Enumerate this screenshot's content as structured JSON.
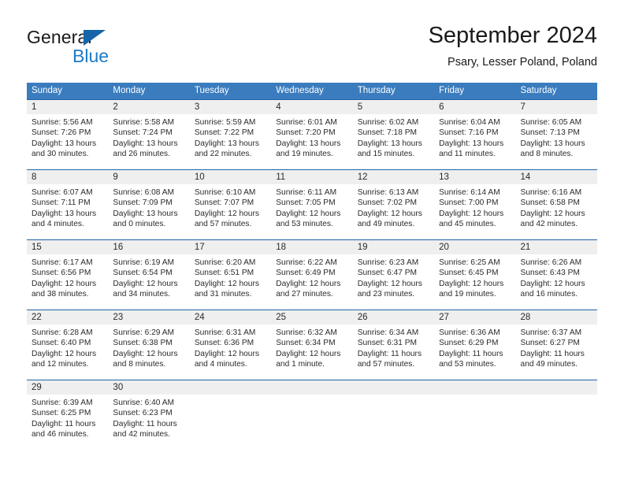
{
  "brand": {
    "name_line1": "General",
    "name_line2": "Blue",
    "triangle_icon": "triangle-icon"
  },
  "header": {
    "title": "September 2024",
    "subtitle": "Psary, Lesser Poland, Poland"
  },
  "colors": {
    "header_blue": "#3a7cbe",
    "rule_blue": "#1f64a8",
    "daynum_band": "#efefef",
    "brand_blue": "#1e7bc4",
    "text": "#2b2b2b"
  },
  "weekdays": [
    "Sunday",
    "Monday",
    "Tuesday",
    "Wednesday",
    "Thursday",
    "Friday",
    "Saturday"
  ],
  "weeks": [
    {
      "days": [
        {
          "num": "1",
          "sunrise": "Sunrise: 5:56 AM",
          "sunset": "Sunset: 7:26 PM",
          "daylight1": "Daylight: 13 hours",
          "daylight2": "and 30 minutes."
        },
        {
          "num": "2",
          "sunrise": "Sunrise: 5:58 AM",
          "sunset": "Sunset: 7:24 PM",
          "daylight1": "Daylight: 13 hours",
          "daylight2": "and 26 minutes."
        },
        {
          "num": "3",
          "sunrise": "Sunrise: 5:59 AM",
          "sunset": "Sunset: 7:22 PM",
          "daylight1": "Daylight: 13 hours",
          "daylight2": "and 22 minutes."
        },
        {
          "num": "4",
          "sunrise": "Sunrise: 6:01 AM",
          "sunset": "Sunset: 7:20 PM",
          "daylight1": "Daylight: 13 hours",
          "daylight2": "and 19 minutes."
        },
        {
          "num": "5",
          "sunrise": "Sunrise: 6:02 AM",
          "sunset": "Sunset: 7:18 PM",
          "daylight1": "Daylight: 13 hours",
          "daylight2": "and 15 minutes."
        },
        {
          "num": "6",
          "sunrise": "Sunrise: 6:04 AM",
          "sunset": "Sunset: 7:16 PM",
          "daylight1": "Daylight: 13 hours",
          "daylight2": "and 11 minutes."
        },
        {
          "num": "7",
          "sunrise": "Sunrise: 6:05 AM",
          "sunset": "Sunset: 7:13 PM",
          "daylight1": "Daylight: 13 hours",
          "daylight2": "and 8 minutes."
        }
      ]
    },
    {
      "days": [
        {
          "num": "8",
          "sunrise": "Sunrise: 6:07 AM",
          "sunset": "Sunset: 7:11 PM",
          "daylight1": "Daylight: 13 hours",
          "daylight2": "and 4 minutes."
        },
        {
          "num": "9",
          "sunrise": "Sunrise: 6:08 AM",
          "sunset": "Sunset: 7:09 PM",
          "daylight1": "Daylight: 13 hours",
          "daylight2": "and 0 minutes."
        },
        {
          "num": "10",
          "sunrise": "Sunrise: 6:10 AM",
          "sunset": "Sunset: 7:07 PM",
          "daylight1": "Daylight: 12 hours",
          "daylight2": "and 57 minutes."
        },
        {
          "num": "11",
          "sunrise": "Sunrise: 6:11 AM",
          "sunset": "Sunset: 7:05 PM",
          "daylight1": "Daylight: 12 hours",
          "daylight2": "and 53 minutes."
        },
        {
          "num": "12",
          "sunrise": "Sunrise: 6:13 AM",
          "sunset": "Sunset: 7:02 PM",
          "daylight1": "Daylight: 12 hours",
          "daylight2": "and 49 minutes."
        },
        {
          "num": "13",
          "sunrise": "Sunrise: 6:14 AM",
          "sunset": "Sunset: 7:00 PM",
          "daylight1": "Daylight: 12 hours",
          "daylight2": "and 45 minutes."
        },
        {
          "num": "14",
          "sunrise": "Sunrise: 6:16 AM",
          "sunset": "Sunset: 6:58 PM",
          "daylight1": "Daylight: 12 hours",
          "daylight2": "and 42 minutes."
        }
      ]
    },
    {
      "days": [
        {
          "num": "15",
          "sunrise": "Sunrise: 6:17 AM",
          "sunset": "Sunset: 6:56 PM",
          "daylight1": "Daylight: 12 hours",
          "daylight2": "and 38 minutes."
        },
        {
          "num": "16",
          "sunrise": "Sunrise: 6:19 AM",
          "sunset": "Sunset: 6:54 PM",
          "daylight1": "Daylight: 12 hours",
          "daylight2": "and 34 minutes."
        },
        {
          "num": "17",
          "sunrise": "Sunrise: 6:20 AM",
          "sunset": "Sunset: 6:51 PM",
          "daylight1": "Daylight: 12 hours",
          "daylight2": "and 31 minutes."
        },
        {
          "num": "18",
          "sunrise": "Sunrise: 6:22 AM",
          "sunset": "Sunset: 6:49 PM",
          "daylight1": "Daylight: 12 hours",
          "daylight2": "and 27 minutes."
        },
        {
          "num": "19",
          "sunrise": "Sunrise: 6:23 AM",
          "sunset": "Sunset: 6:47 PM",
          "daylight1": "Daylight: 12 hours",
          "daylight2": "and 23 minutes."
        },
        {
          "num": "20",
          "sunrise": "Sunrise: 6:25 AM",
          "sunset": "Sunset: 6:45 PM",
          "daylight1": "Daylight: 12 hours",
          "daylight2": "and 19 minutes."
        },
        {
          "num": "21",
          "sunrise": "Sunrise: 6:26 AM",
          "sunset": "Sunset: 6:43 PM",
          "daylight1": "Daylight: 12 hours",
          "daylight2": "and 16 minutes."
        }
      ]
    },
    {
      "days": [
        {
          "num": "22",
          "sunrise": "Sunrise: 6:28 AM",
          "sunset": "Sunset: 6:40 PM",
          "daylight1": "Daylight: 12 hours",
          "daylight2": "and 12 minutes."
        },
        {
          "num": "23",
          "sunrise": "Sunrise: 6:29 AM",
          "sunset": "Sunset: 6:38 PM",
          "daylight1": "Daylight: 12 hours",
          "daylight2": "and 8 minutes."
        },
        {
          "num": "24",
          "sunrise": "Sunrise: 6:31 AM",
          "sunset": "Sunset: 6:36 PM",
          "daylight1": "Daylight: 12 hours",
          "daylight2": "and 4 minutes."
        },
        {
          "num": "25",
          "sunrise": "Sunrise: 6:32 AM",
          "sunset": "Sunset: 6:34 PM",
          "daylight1": "Daylight: 12 hours",
          "daylight2": "and 1 minute."
        },
        {
          "num": "26",
          "sunrise": "Sunrise: 6:34 AM",
          "sunset": "Sunset: 6:31 PM",
          "daylight1": "Daylight: 11 hours",
          "daylight2": "and 57 minutes."
        },
        {
          "num": "27",
          "sunrise": "Sunrise: 6:36 AM",
          "sunset": "Sunset: 6:29 PM",
          "daylight1": "Daylight: 11 hours",
          "daylight2": "and 53 minutes."
        },
        {
          "num": "28",
          "sunrise": "Sunrise: 6:37 AM",
          "sunset": "Sunset: 6:27 PM",
          "daylight1": "Daylight: 11 hours",
          "daylight2": "and 49 minutes."
        }
      ]
    },
    {
      "days": [
        {
          "num": "29",
          "sunrise": "Sunrise: 6:39 AM",
          "sunset": "Sunset: 6:25 PM",
          "daylight1": "Daylight: 11 hours",
          "daylight2": "and 46 minutes."
        },
        {
          "num": "30",
          "sunrise": "Sunrise: 6:40 AM",
          "sunset": "Sunset: 6:23 PM",
          "daylight1": "Daylight: 11 hours",
          "daylight2": "and 42 minutes."
        },
        {
          "num": "",
          "sunrise": "",
          "sunset": "",
          "daylight1": "",
          "daylight2": ""
        },
        {
          "num": "",
          "sunrise": "",
          "sunset": "",
          "daylight1": "",
          "daylight2": ""
        },
        {
          "num": "",
          "sunrise": "",
          "sunset": "",
          "daylight1": "",
          "daylight2": ""
        },
        {
          "num": "",
          "sunrise": "",
          "sunset": "",
          "daylight1": "",
          "daylight2": ""
        },
        {
          "num": "",
          "sunrise": "",
          "sunset": "",
          "daylight1": "",
          "daylight2": ""
        }
      ]
    }
  ]
}
